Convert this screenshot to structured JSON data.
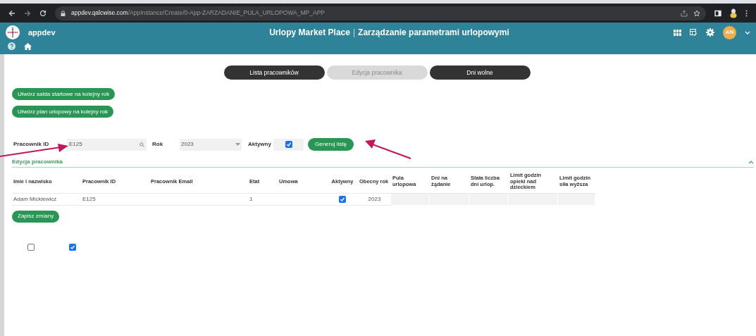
{
  "browser": {
    "url_host": "appdev.qalcwise.com",
    "url_path": "/AppInstance/Create/0-App-ZARZADANIE_PULA_URLOPOWA_MP_APP"
  },
  "header": {
    "app_name": "appdev",
    "title": "Urlopy Market Place",
    "separator": "|",
    "subtitle": "Zarządzanie parametrami urlopowymi",
    "avatar": "AN"
  },
  "tabs": [
    {
      "label": "Lista pracowników",
      "selected": false
    },
    {
      "label": "Edycja pracownika",
      "selected": true
    },
    {
      "label": "Dni wolne",
      "selected": false
    }
  ],
  "actions": [
    "Utwórz salda startowe na kolejny rok",
    "Utwórz plan urlopowy na kolejny rok"
  ],
  "filters": {
    "employee_id_label": "Pracownik ID",
    "employee_id_value": "E125",
    "year_label": "Rok",
    "year_value": "2023",
    "active_label": "Aktywny",
    "active_checked": true,
    "generate_button": "Generuj listę"
  },
  "section": {
    "title": "Edycja pracownika",
    "expanded": true
  },
  "table": {
    "columns": [
      "Imie i nazwisko",
      "Pracownik ID",
      "Pracownik Email",
      "Etat",
      "Umowa",
      "Aktywny",
      "Obecny rok",
      "Pula urlopowa",
      "Dni na żądanie",
      "Stała liczba dni urlop.",
      "Limit godzin opieki nad dzieckiem",
      "Limit godzin siła wyższa"
    ],
    "rows": [
      {
        "name": "Adam Mickiewicz",
        "employee_id": "E125",
        "etat": "1",
        "active": true,
        "year": "2023"
      }
    ]
  },
  "save_button": "Zapisz zmiany",
  "bottom_checkboxes": [
    {
      "checked": false
    },
    {
      "checked": true
    }
  ]
}
